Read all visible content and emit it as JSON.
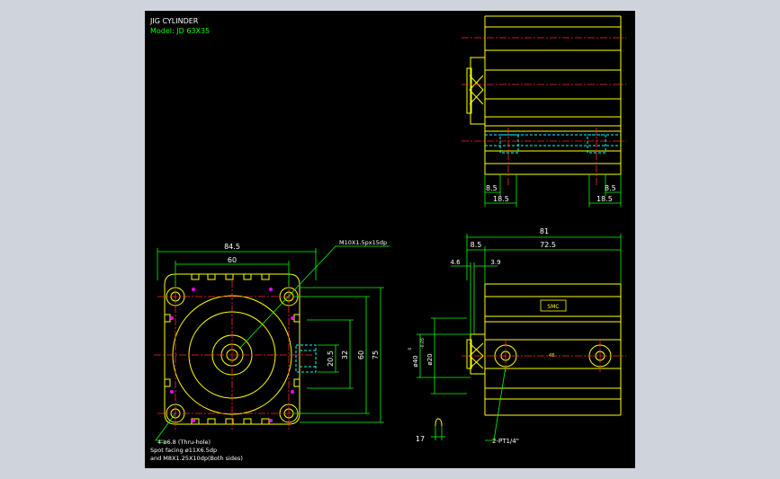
{
  "title": {
    "line1": "JIG CYLINDER",
    "line2": "Model: JD 63X35"
  },
  "colors": {
    "background": "#000000",
    "frame": "#cfd3db",
    "outline": "#ffff00",
    "dimension": "#00ff00",
    "centerline": "#ff2a2a",
    "hidden": "#00ffff",
    "marker": "#ff00ff"
  },
  "front_view": {
    "dim_width_outer": "84.5",
    "dim_width_inner": "60",
    "dim_height_outer": "75",
    "dim_height_inner": "60",
    "dim_port_depth": "32",
    "dim_port_height": "20.5",
    "callout_thread": "M10X1.5px15dp",
    "note_line1": "4-ø6.8 (Thru-hole)",
    "note_line2": "Spot facing ø11X6.5dp",
    "note_line3": "and M8X1.25X10dp(Both sides)"
  },
  "side_view": {
    "dim_length_total": "81",
    "dim_length_body": "72.5",
    "dim_front_offset": "8.5",
    "dim_flange_a": "4.6",
    "dim_flange_b": "3.9",
    "dim_bore": "ø40",
    "dim_bore_tol": "0",
    "dim_bore_tol2": "-0.05",
    "dim_rod": "ø20",
    "dim_rod_end": "17",
    "callout_ports": "2-PT1/4\"",
    "label_text": "SMC",
    "small_mark": "48"
  },
  "top_view": {
    "dim_left_small": "8.5",
    "dim_right_small": "8.5",
    "dim_left_large": "18.5",
    "dim_right_large": "18.5"
  }
}
